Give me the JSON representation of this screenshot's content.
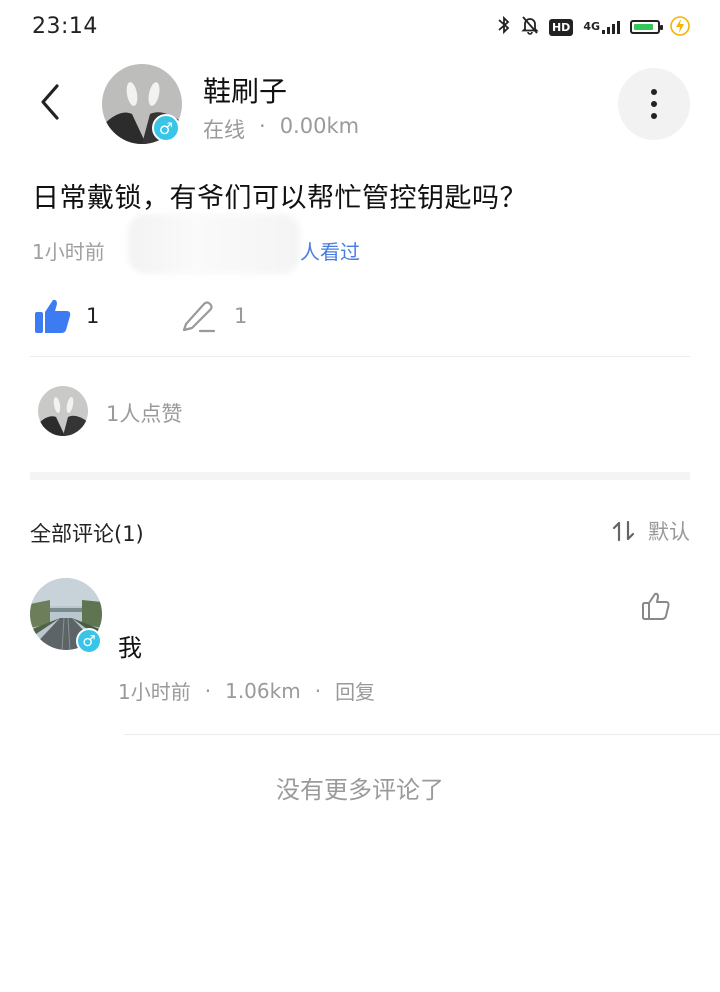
{
  "status_bar": {
    "time": "23:14",
    "hd_label": "HD",
    "network_label": "4G",
    "battery_level": 0.85,
    "icons": [
      "bluetooth-icon",
      "mute-bell-icon",
      "hd-icon",
      "signal-icon",
      "battery-icon",
      "charging-icon"
    ]
  },
  "header": {
    "user_name": "鞋刷子",
    "status": "在线",
    "separator": "·",
    "distance": "0.00km",
    "gender_symbol": "♂"
  },
  "post": {
    "text": "日常戴锁，有爷们可以帮忙管控钥匙吗？",
    "time": "1小时前",
    "views_suffix": "人看过",
    "like_count": "1",
    "comment_count": "1",
    "likes_summary": "1人点赞"
  },
  "comments_section": {
    "title": "全部评论(1)",
    "sort_label": "默认",
    "sort_icon_glyph": "⇅",
    "comments": [
      {
        "text": "我",
        "time": "1小时前",
        "distance": "1.06km",
        "reply_label": "回复",
        "separator": "·",
        "gender_symbol": "♂"
      }
    ],
    "no_more_text": "没有更多评论了"
  },
  "colors": {
    "accent_blue": "#3d7bf2",
    "link_blue": "#4a7de0",
    "gender_badge": "#38c5e8",
    "battery_green": "#34c759",
    "charge_yellow": "#f5b400"
  }
}
